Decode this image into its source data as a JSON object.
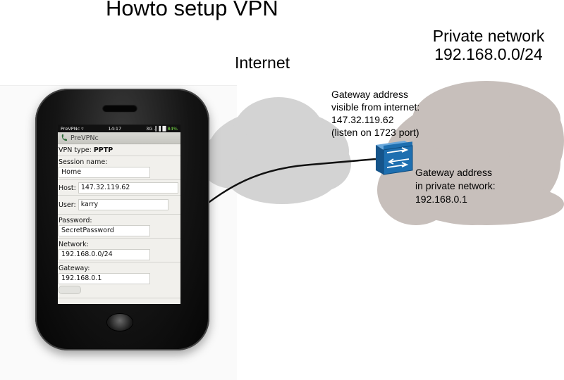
{
  "title": "Howto setup VPN",
  "internet_label": "Internet",
  "private_network": {
    "line1": "Private network",
    "line2": "192.168.0.0/24"
  },
  "gateway_public": [
    "Gateway address",
    "visible from internet:",
    "147.32.119.62",
    "(listen on 1723 port)"
  ],
  "gateway_private": [
    "Gateway address",
    "in private network:",
    "192.168.0.1"
  ],
  "colors": {
    "internet_cloud": "#d3d3d3",
    "private_cloud": "#c7bfbb",
    "router": "#1e6fb0",
    "phone_body": "#111111"
  },
  "phone": {
    "status": {
      "app": "PreVPNc ▿",
      "time": "14:17",
      "signal": "3G .▎▌█",
      "battery": "84%"
    },
    "app_title": "PreVPNc",
    "vpn_type_label": "VPN type:",
    "vpn_type_value": "PPTP",
    "session_label": "Session name:",
    "session_value": "Home",
    "host_label": "Host:",
    "host_value": "147.32.119.62",
    "user_label": "User:",
    "user_value": "karry",
    "password_label": "Password:",
    "password_value": "SecretPassword",
    "network_label": "Network:",
    "network_value": "192.168.0.0/24",
    "gateway_label": "Gateway:",
    "gateway_value": "192.168.0.1"
  }
}
